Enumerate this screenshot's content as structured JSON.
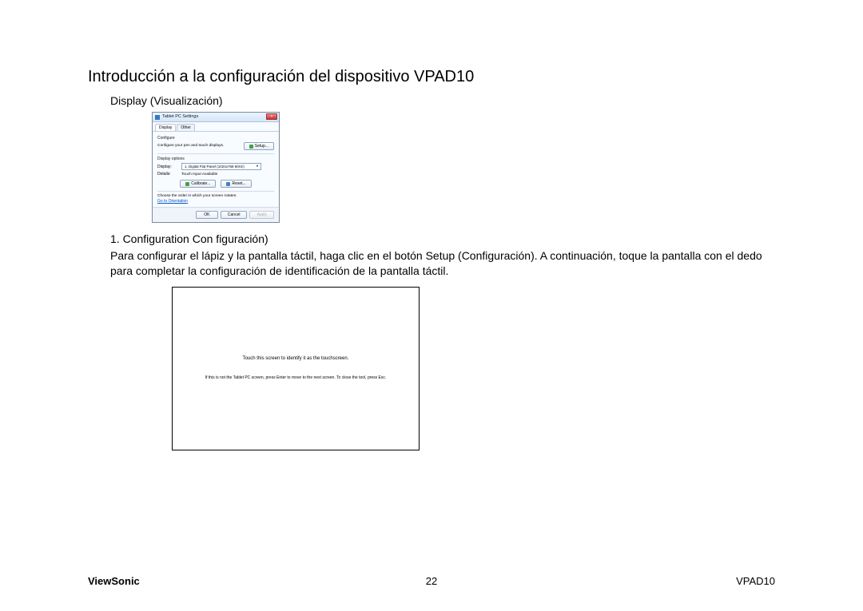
{
  "heading": "Introducción a la configuración del dispositivo VPAD10",
  "subheading": "Display (Visualización)",
  "settings_window": {
    "title": "Tablet PC Settings",
    "close_glyph": "×",
    "tab_display": "Display",
    "tab_other": "Other",
    "configure_label": "Configure",
    "configure_desc": "Configure your pen and touch displays.",
    "setup_btn": "Setup...",
    "display_options_label": "Display options",
    "display_lbl": "Display:",
    "display_value": "1. Digital Flat Panel (1024x768 60Hz)",
    "details_lbl": "Details:",
    "details_value": "Touch Input Available",
    "calibrate_btn": "Calibrate...",
    "reset_btn": "Reset...",
    "rotation_text": "Choose the order in which your screen rotates.",
    "orientation_link": "Go to Orientation",
    "ok_btn": "OK",
    "cancel_btn": "Cancel",
    "apply_btn": "Apply"
  },
  "config_line": "1. Configuration Con figuración)",
  "body_para": "Para configurar el lápiz y la pantalla táctil, haga clic en el botón Setup (Configuración). A continuación, toque la pantalla con el dedo para completar la configuración de identificación de la pantalla táctil.",
  "touch_panel": {
    "line1": "Touch this screen to identify it as the touchscreen.",
    "line2": "If this is not the Tablet PC screen, press Enter to move to the next screen. To close the tool, press Esc."
  },
  "footer": {
    "left": "ViewSonic",
    "center": "22",
    "right": "VPAD10"
  }
}
